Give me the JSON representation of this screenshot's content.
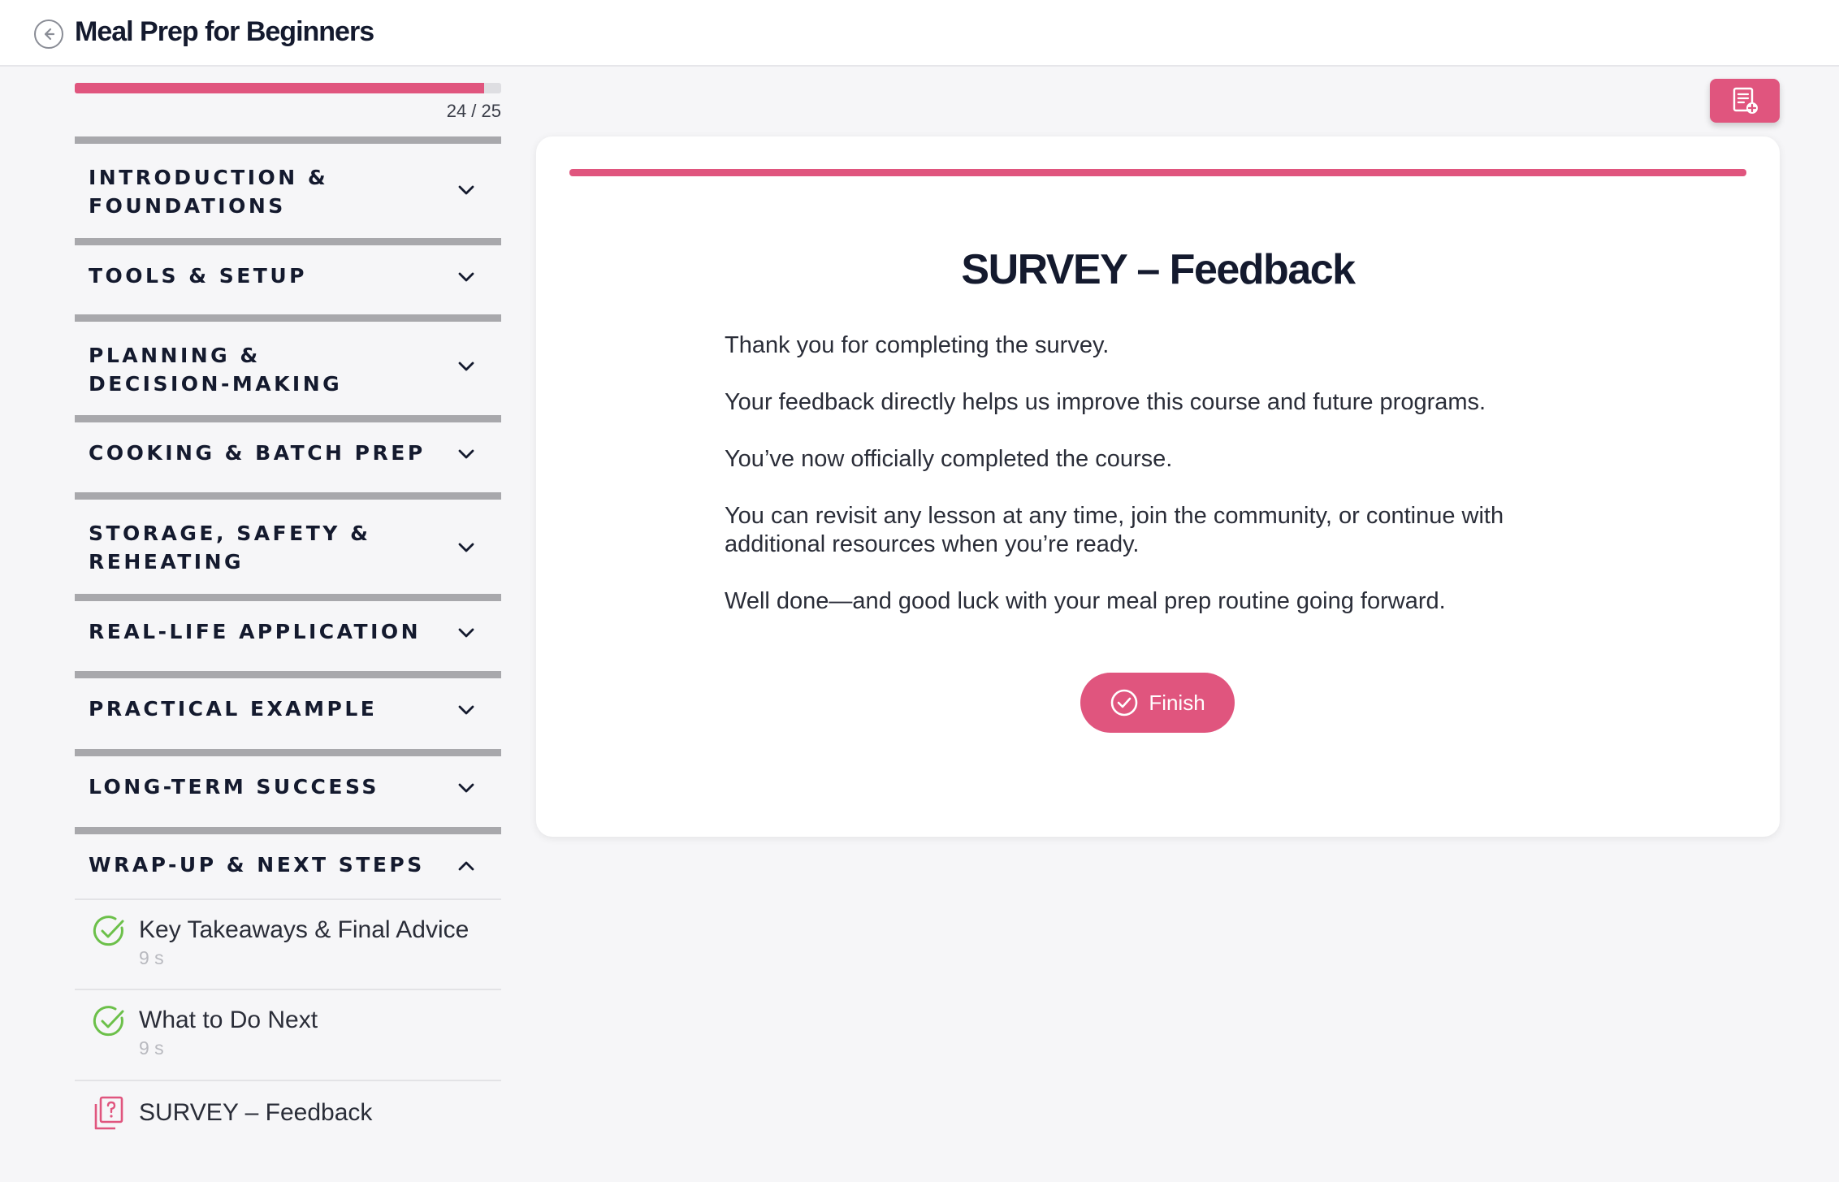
{
  "header": {
    "back_icon": "arrow-left-circle-icon",
    "title": "Meal Prep for Beginners"
  },
  "progress": {
    "completed": 24,
    "total": 25,
    "label": "24 / 25"
  },
  "sections": [
    {
      "label": "INTRODUCTION & FOUNDATIONS",
      "expanded": false
    },
    {
      "label": "TOOLS & SETUP",
      "expanded": false
    },
    {
      "label": "PLANNING & DECISION-MAKING",
      "expanded": false
    },
    {
      "label": "COOKING & BATCH PREP",
      "expanded": false
    },
    {
      "label": "STORAGE, SAFETY & REHEATING",
      "expanded": false
    },
    {
      "label": "REAL-LIFE APPLICATION",
      "expanded": false
    },
    {
      "label": "PRACTICAL EXAMPLE",
      "expanded": false
    },
    {
      "label": "LONG-TERM SUCCESS",
      "expanded": false
    },
    {
      "label": "WRAP-UP & NEXT STEPS",
      "expanded": true
    }
  ],
  "lessons": [
    {
      "title": "Key Takeaways & Final Advice",
      "duration": "9 s",
      "status": "completed",
      "icon": "check-circle-icon"
    },
    {
      "title": "What to Do Next",
      "duration": "9 s",
      "status": "completed",
      "icon": "check-circle-icon"
    },
    {
      "title": "SURVEY – Feedback",
      "duration": "",
      "status": "current",
      "icon": "survey-icon"
    }
  ],
  "content": {
    "title": "SURVEY – Feedback",
    "paragraphs": [
      "Thank you for completing the survey.",
      "Your feedback directly helps us improve this course and future programs.",
      "You’ve now officially completed the course.",
      "You can revisit any lesson at any time, join the community, or continue with additional resources when you’re ready.",
      "Well done—and good luck with your meal prep routine going forward."
    ],
    "finish_label": "Finish"
  },
  "colors": {
    "accent": "#e0557e",
    "success": "#6cc04a",
    "text": "#141a2e"
  }
}
